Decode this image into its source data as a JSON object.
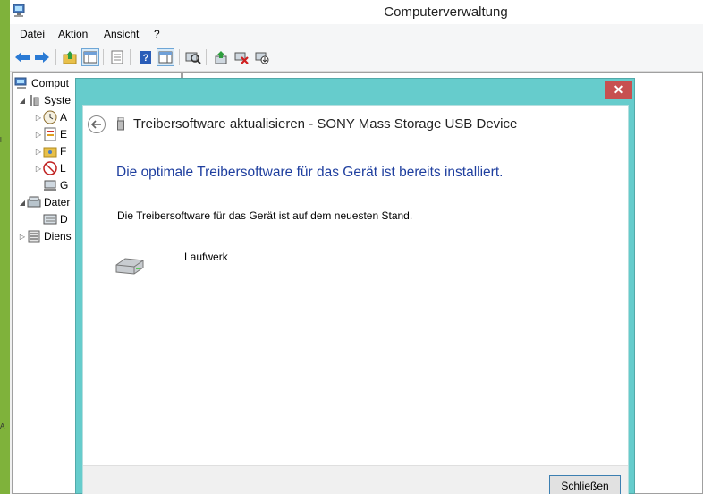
{
  "window": {
    "title": "Computerverwaltung"
  },
  "menu": [
    "Datei",
    "Aktion",
    "Ansicht",
    "?"
  ],
  "toolbar": {
    "buttons": [
      "back-icon",
      "forward-icon",
      "up-folder-icon",
      "show-hide-tree-icon",
      "export-list-icon",
      "help-icon",
      "properties-icon",
      "scan-hardware-icon",
      "update-driver-icon",
      "uninstall-icon",
      "disable-icon"
    ]
  },
  "tree": {
    "items": [
      {
        "label": "Comput",
        "icon": "computer-management-icon"
      },
      {
        "label": "Syste",
        "icon": "system-tools-icon"
      },
      {
        "label": "A",
        "icon": "task-scheduler-icon"
      },
      {
        "label": "E",
        "icon": "event-viewer-icon"
      },
      {
        "label": "F",
        "icon": "shared-folders-icon"
      },
      {
        "label": "L",
        "icon": "local-users-icon"
      },
      {
        "label": "G",
        "icon": "device-manager-icon"
      },
      {
        "label": "Dater",
        "icon": "storage-icon"
      },
      {
        "label": "D",
        "icon": "disk-management-icon"
      },
      {
        "label": "Diens",
        "icon": "services-icon"
      }
    ]
  },
  "dialog": {
    "title": "Treibersoftware aktualisieren - SONY Mass Storage USB Device",
    "close_symbol": "✕",
    "headline": "Die optimale Treibersoftware für das Gerät ist bereits installiert.",
    "subtext": "Die Treibersoftware für das Gerät ist auf dem neuesten Stand.",
    "device_label": "Laufwerk",
    "close_button": "Schließen"
  },
  "colors": {
    "dialog_frame": "#66cccc",
    "headline": "#1f3f9f",
    "close_red": "#c75050",
    "desktop": "#7fb23b"
  }
}
